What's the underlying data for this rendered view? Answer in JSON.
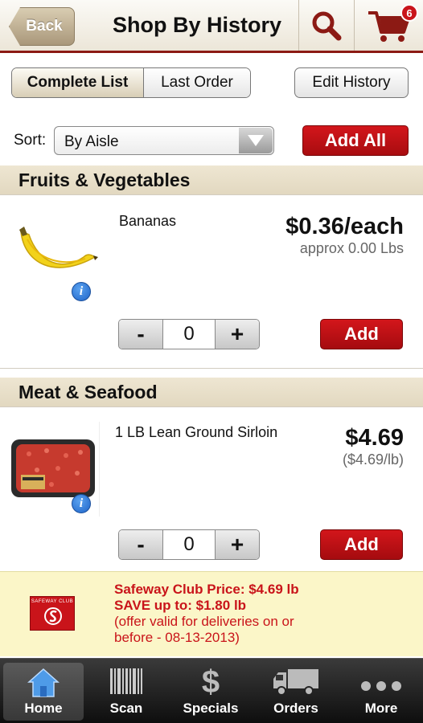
{
  "header": {
    "back_label": "Back",
    "title": "Shop By History",
    "cart_count": "6"
  },
  "tabs": {
    "complete_list": "Complete List",
    "last_order": "Last Order",
    "edit_history": "Edit History"
  },
  "sort": {
    "label": "Sort:",
    "value": "By Aisle",
    "add_all": "Add All"
  },
  "sections": [
    {
      "title": "Fruits & Vegetables",
      "item": {
        "name": "Bananas",
        "price": "$0.36/each",
        "subprice": "approx 0.00 Lbs",
        "quantity": "0",
        "minus": "-",
        "plus": "+",
        "add": "Add"
      }
    },
    {
      "title": "Meat & Seafood",
      "item": {
        "name": "1 LB Lean Ground Sirloin",
        "price": "$4.69",
        "subprice": "($4.69/lb)",
        "quantity": "0",
        "minus": "-",
        "plus": "+",
        "add": "Add"
      }
    }
  ],
  "promo": {
    "logo_text": "SAFEWAY CLUB",
    "line1": "Safeway Club Price: $4.69 lb",
    "line2": "SAVE up to: $1.80 lb",
    "line3": "(offer valid for deliveries on or",
    "line4": "before - 08-13-2013)"
  },
  "tabbar": {
    "home": "Home",
    "scan": "Scan",
    "specials": "Specials",
    "specials_glyph": "$",
    "orders": "Orders",
    "more": "More"
  },
  "colors": {
    "accent_red": "#c9141a",
    "header_rule": "#8c1a14",
    "section_bg": "#e8dfca",
    "promo_bg": "#fbf6c8"
  }
}
